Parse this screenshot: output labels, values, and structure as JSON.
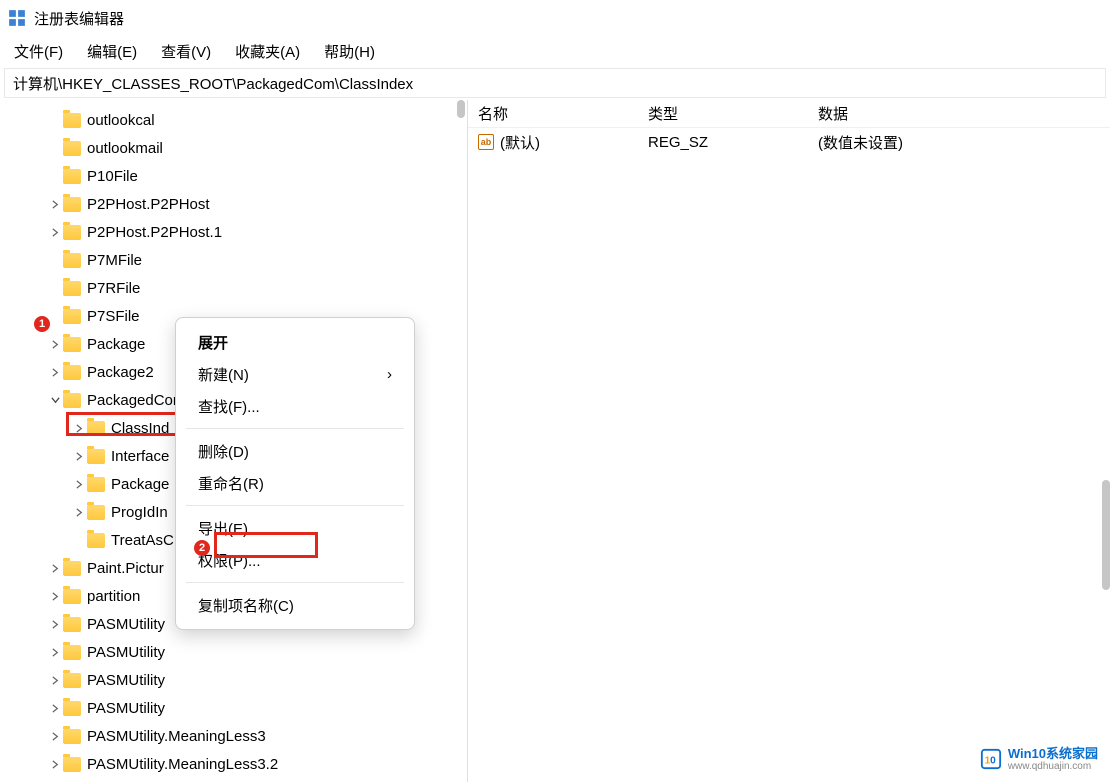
{
  "window": {
    "title": "注册表编辑器"
  },
  "menu": {
    "file": "文件(F)",
    "edit": "编辑(E)",
    "view": "查看(V)",
    "favorites": "收藏夹(A)",
    "help": "帮助(H)"
  },
  "address": "计算机\\HKEY_CLASSES_ROOT\\PackagedCom\\ClassIndex",
  "tree": [
    {
      "indent": 48,
      "chev": "",
      "label": "outlookcal"
    },
    {
      "indent": 48,
      "chev": "",
      "label": "outlookmail"
    },
    {
      "indent": 48,
      "chev": "",
      "label": "P10File"
    },
    {
      "indent": 48,
      "chev": "right",
      "label": "P2PHost.P2PHost"
    },
    {
      "indent": 48,
      "chev": "right",
      "label": "P2PHost.P2PHost.1"
    },
    {
      "indent": 48,
      "chev": "",
      "label": "P7MFile"
    },
    {
      "indent": 48,
      "chev": "",
      "label": "P7RFile"
    },
    {
      "indent": 48,
      "chev": "",
      "label": "P7SFile"
    },
    {
      "indent": 48,
      "chev": "right",
      "label": "Package"
    },
    {
      "indent": 48,
      "chev": "right",
      "label": "Package2"
    },
    {
      "indent": 48,
      "chev": "down",
      "label": "PackagedCom"
    },
    {
      "indent": 72,
      "chev": "right",
      "label": "ClassInd"
    },
    {
      "indent": 72,
      "chev": "right",
      "label": "Interface"
    },
    {
      "indent": 72,
      "chev": "right",
      "label": "Package"
    },
    {
      "indent": 72,
      "chev": "right",
      "label": "ProgIdIn"
    },
    {
      "indent": 72,
      "chev": "",
      "label": "TreatAsC"
    },
    {
      "indent": 48,
      "chev": "right",
      "label": "Paint.Pictur"
    },
    {
      "indent": 48,
      "chev": "right",
      "label": "partition"
    },
    {
      "indent": 48,
      "chev": "right",
      "label": "PASMUtility"
    },
    {
      "indent": 48,
      "chev": "right",
      "label": "PASMUtility"
    },
    {
      "indent": 48,
      "chev": "right",
      "label": "PASMUtility"
    },
    {
      "indent": 48,
      "chev": "right",
      "label": "PASMUtility"
    },
    {
      "indent": 48,
      "chev": "right",
      "label": "PASMUtility.MeaningLess3"
    },
    {
      "indent": 48,
      "chev": "right",
      "label": "PASMUtility.MeaningLess3.2"
    }
  ],
  "context_menu": {
    "expand": "展开",
    "new": "新建(N)",
    "find": "查找(F)...",
    "delete": "删除(D)",
    "rename": "重命名(R)",
    "export": "导出(E)",
    "permissions": "权限(P)...",
    "copy_key_name": "复制项名称(C)"
  },
  "list": {
    "headers": {
      "name": "名称",
      "type": "类型",
      "data": "数据"
    },
    "rows": [
      {
        "icon": "ab",
        "name": "(默认)",
        "type": "REG_SZ",
        "data": "(数值未设置)"
      }
    ]
  },
  "badges": {
    "one": "1",
    "two": "2"
  },
  "watermark": {
    "title": "Win10系统家园",
    "sub": "www.qdhuajin.com"
  }
}
